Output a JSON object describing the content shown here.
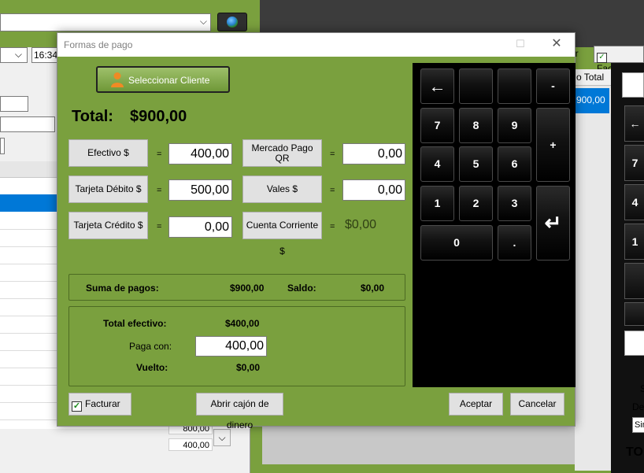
{
  "background": {
    "time_value": "16:34",
    "amounts": [
      "800,00",
      "400,00"
    ],
    "right_header": "o Total",
    "right_selected_value": "900,00",
    "facturar_label": "Facturar",
    "right_keys": [
      "←",
      "7",
      "4",
      "1",
      "",
      ""
    ],
    "right_texts": [
      "S",
      "De"
    ],
    "right_select_value": "Sin",
    "right_total_label": "TO",
    "ir_label": "ir"
  },
  "dialog": {
    "title": "Formas de pago",
    "minimize_icon": "—",
    "maximize_icon": "☐",
    "close_icon": "✕",
    "select_client_label": "Seleccionar Cliente",
    "total_label": "Total:",
    "total_value": "$900,00",
    "payments": {
      "efectivo_label": "Efectivo $",
      "efectivo_value": "400,00",
      "debito_label": "Tarjeta Débito $",
      "debito_value": "500,00",
      "credito_label": "Tarjeta Crédito $",
      "credito_value": "0,00",
      "mercadopago_label": "Mercado Pago QR",
      "mercadopago_value": "0,00",
      "vales_label": "Vales $",
      "vales_value": "0,00",
      "cuenta_corriente_label": "Cuenta Corriente $",
      "cuenta_corriente_value": "$0,00",
      "equals": "="
    },
    "summary": {
      "suma_label": "Suma de pagos:",
      "suma_value": "$900,00",
      "saldo_label": "Saldo:",
      "saldo_value": "$0,00"
    },
    "cash": {
      "total_efectivo_label": "Total efectivo:",
      "total_efectivo_value": "$400,00",
      "paga_con_label": "Paga con:",
      "paga_con_value": "400,00",
      "vuelto_label": "Vuelto:",
      "vuelto_value": "$0,00"
    },
    "keypad": {
      "backspace": "←",
      "minus": "-",
      "plus": "+",
      "enter": "↵",
      "zero": "0",
      "dot": ".",
      "digits": [
        "7",
        "8",
        "9",
        "4",
        "5",
        "6",
        "1",
        "2",
        "3"
      ]
    },
    "footer": {
      "facturar_label": "Facturar",
      "facturar_checked": true,
      "check_mark": "✓",
      "abrir_cajon_label": "Abrir cajón de dinero",
      "aceptar_label": "Aceptar",
      "cancelar_label": "Cancelar"
    }
  }
}
